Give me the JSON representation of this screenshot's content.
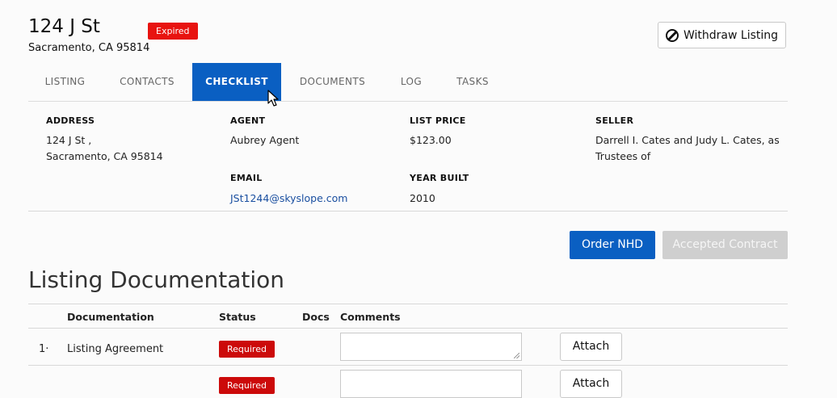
{
  "header": {
    "title": "124 J St",
    "subtitle": "Sacramento, CA 95814",
    "status_badge": "Expired",
    "withdraw_label": "Withdraw Listing"
  },
  "tabs": [
    {
      "label": "LISTING",
      "active": false
    },
    {
      "label": "CONTACTS",
      "active": false
    },
    {
      "label": "CHECKLIST",
      "active": true
    },
    {
      "label": "DOCUMENTS",
      "active": false
    },
    {
      "label": "LOG",
      "active": false
    },
    {
      "label": "TASKS",
      "active": false
    }
  ],
  "details": {
    "address_label": "ADDRESS",
    "address_line1": "124 J St ,",
    "address_line2": "Sacramento, CA 95814",
    "agent_label": "AGENT",
    "agent_value": "Aubrey Agent",
    "email_label": "EMAIL",
    "email_value": "JSt1244@skyslope.com",
    "price_label": "LIST PRICE",
    "price_value": "$123.00",
    "year_label": "YEAR BUILT",
    "year_value": "2010",
    "seller_label": "SELLER",
    "seller_line1": "Darrell I. Cates and Judy L. Cates, as",
    "seller_line2": "Trustees of"
  },
  "actions": {
    "order_nhd": "Order NHD",
    "accepted_contract": "Accepted Contract"
  },
  "section": {
    "title": "Listing Documentation",
    "columns": [
      "Documentation",
      "Status",
      "Docs",
      "Comments"
    ]
  },
  "rows": [
    {
      "index": "1·",
      "name": "Listing Agreement",
      "status": "Required",
      "attach": "Attach"
    },
    {
      "index": "",
      "name": "",
      "status": "Required",
      "attach": "Attach"
    }
  ],
  "colors": {
    "accent": "#0a5fc2",
    "expired": "#e8130f",
    "required": "#cc0a0a"
  }
}
